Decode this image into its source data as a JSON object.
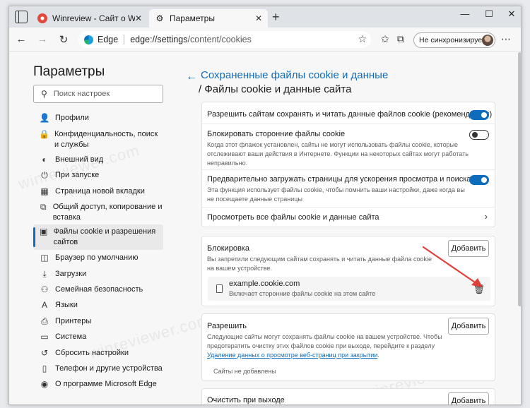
{
  "browser": {
    "tabs": [
      {
        "label": "Winreview - Сайт о Windows",
        "icon": "winreview-favicon"
      },
      {
        "label": "Параметры",
        "icon": "gear-icon"
      }
    ],
    "new_tab": "+",
    "url_brand": "Edge",
    "url_host": "edge://settings",
    "url_path": "/content/cookies",
    "profile_label": "Не синхронизируется"
  },
  "sidebar": {
    "title": "Параметры",
    "search_placeholder": "Поиск настроек",
    "items": [
      {
        "label": "Профили",
        "icon": "profile-icon"
      },
      {
        "label": "Конфиденциальность, поиск и службы",
        "icon": "lock-icon"
      },
      {
        "label": "Внешний вид",
        "icon": "appearance-icon"
      },
      {
        "label": "При запуске",
        "icon": "power-icon"
      },
      {
        "label": "Страница новой вкладки",
        "icon": "new-tab-page-icon"
      },
      {
        "label": "Общий доступ, копирование и вставка",
        "icon": "share-icon"
      },
      {
        "label": "Файлы cookie и разрешения сайтов",
        "icon": "cookie-permissions-icon",
        "selected": true
      },
      {
        "label": "Браузер по умолчанию",
        "icon": "default-browser-icon"
      },
      {
        "label": "Загрузки",
        "icon": "download-icon"
      },
      {
        "label": "Семейная безопасность",
        "icon": "family-icon"
      },
      {
        "label": "Языки",
        "icon": "languages-icon"
      },
      {
        "label": "Принтеры",
        "icon": "printer-icon"
      },
      {
        "label": "Система",
        "icon": "system-icon"
      },
      {
        "label": "Сбросить настройки",
        "icon": "reset-icon"
      },
      {
        "label": "Телефон и другие устройства",
        "icon": "phone-icon"
      },
      {
        "label": "О программе Microsoft Edge",
        "icon": "edge-logo-icon"
      }
    ]
  },
  "main": {
    "breadcrumb_parent": "Сохраненные файлы cookie и данные",
    "breadcrumb_current": "/ Файлы cookie и данные сайта",
    "settings": {
      "allow_save": {
        "title": "Разрешить сайтам сохранять и читать данные файлов cookie (рекомендуется)",
        "on": true
      },
      "block_third_party": {
        "title": "Блокировать сторонние файлы cookie",
        "desc": "Когда этот флажок установлен, сайты не могут использовать файлы cookie, которые отслеживают ваши действия в Интернете. Функции на некоторых сайтах могут работать неправильно.",
        "on": false
      },
      "preload": {
        "title": "Предварительно загружать страницы для ускорения просмотра и поиска",
        "desc": "Эта функция использует файлы cookie, чтобы помнить ваши настройки, даже когда вы не посещаете данные страницы",
        "on": true
      },
      "view_all": {
        "title": "Просмотреть все файлы cookie и данные сайта"
      }
    },
    "block": {
      "title": "Блокировка",
      "desc": "Вы запретили следующим сайтам сохранять и читать данные файла cookie на вашем устройстве.",
      "add_label": "Добавить",
      "site": {
        "name": "example.cookie.com",
        "desc": "Включает сторонние файлы cookie на этом сайте"
      }
    },
    "allow": {
      "title": "Разрешить",
      "desc_prefix": "Следующие сайты могут сохранять файлы cookie на вашем устройстве. Чтобы предотвратить очистку этих файлов cookie при выходе, перейдите к разделу ",
      "desc_link": "Удаление данных о просмотре веб-страниц при закрытии",
      "desc_suffix": ".",
      "empty": "Сайты не добавлены",
      "add_label": "Добавить"
    },
    "clear_on_exit": {
      "title": "Очистить при выходе",
      "add_label": "Добавить"
    }
  },
  "colors": {
    "accent": "#0f6cbd",
    "annotation_arrow": "#e0403a"
  },
  "watermark": "winreviewer.com"
}
